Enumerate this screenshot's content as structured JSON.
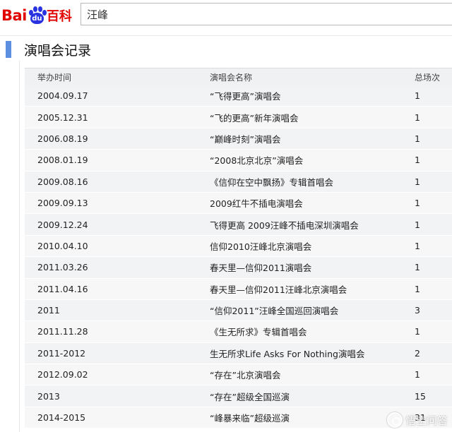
{
  "header": {
    "logo": {
      "left": "Bai",
      "pad": "du",
      "right": "百科"
    },
    "search": {
      "value": "汪峰",
      "placeholder": ""
    }
  },
  "section": {
    "title": "演唱会记录"
  },
  "table": {
    "headers": [
      "举办时间",
      "演唱会名称",
      "总场次"
    ],
    "rows": [
      [
        "2004.09.17",
        "“飞得更高”演唱会",
        "1"
      ],
      [
        "2005.12.31",
        "“飞的更高”新年演唱会",
        "1"
      ],
      [
        "2006.08.19",
        "“巅峰时刻”演唱会",
        "1"
      ],
      [
        "2008.01.19",
        "“2008北京北京”演唱会",
        "1"
      ],
      [
        "2009.08.16",
        "《信仰在空中飘扬》专辑首唱会",
        "1"
      ],
      [
        "2009.09.13",
        "2009红牛不插电演唱会",
        "1"
      ],
      [
        "2009.12.24",
        "飞得更高 2009汪峰不插电深圳演唱会",
        "1"
      ],
      [
        "2010.04.10",
        "信仰2010汪峰北京演唱会",
        "1"
      ],
      [
        "2011.03.26",
        "春天里—信仰2011演唱会",
        "1"
      ],
      [
        "2011.04.16",
        "春天里—信仰2011汪峰北京演唱会",
        "1"
      ],
      [
        "2011",
        "“信仰2011”汪峰全国巡回演唱会",
        "3"
      ],
      [
        "2011.11.28",
        "《生无所求》专辑首唱会",
        "1"
      ],
      [
        "2011-2012",
        "生无所求Life Asks For Nothing演唱会",
        "2"
      ],
      [
        "2012.09.02",
        "“存在”北京演唱会",
        "1"
      ],
      [
        "2013",
        "“存在”超级全国巡演",
        "15"
      ],
      [
        "2014-2015",
        "“峰暴来临”超级巡演",
        "31"
      ]
    ]
  },
  "watermark": {
    "text": "悟空问答"
  },
  "colors": {
    "brand_red": "#e10601",
    "brand_blue": "#2932e1",
    "section_marker": "#5c8fe0"
  }
}
